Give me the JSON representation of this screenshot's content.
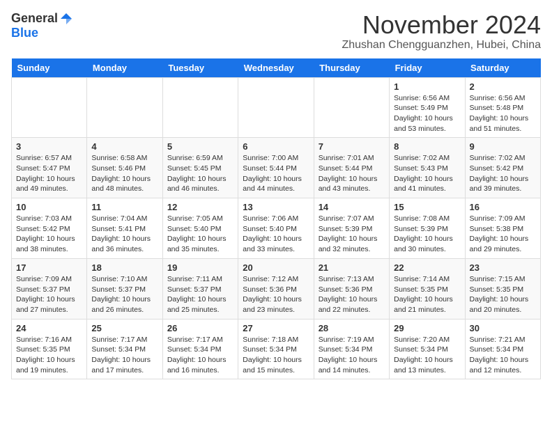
{
  "header": {
    "logo_general": "General",
    "logo_blue": "Blue",
    "month": "November 2024",
    "location": "Zhushan Chengguanzhen, Hubei, China"
  },
  "weekdays": [
    "Sunday",
    "Monday",
    "Tuesday",
    "Wednesday",
    "Thursday",
    "Friday",
    "Saturday"
  ],
  "weeks": [
    [
      {
        "day": "",
        "info": ""
      },
      {
        "day": "",
        "info": ""
      },
      {
        "day": "",
        "info": ""
      },
      {
        "day": "",
        "info": ""
      },
      {
        "day": "",
        "info": ""
      },
      {
        "day": "1",
        "info": "Sunrise: 6:56 AM\nSunset: 5:49 PM\nDaylight: 10 hours and 53 minutes."
      },
      {
        "day": "2",
        "info": "Sunrise: 6:56 AM\nSunset: 5:48 PM\nDaylight: 10 hours and 51 minutes."
      }
    ],
    [
      {
        "day": "3",
        "info": "Sunrise: 6:57 AM\nSunset: 5:47 PM\nDaylight: 10 hours and 49 minutes."
      },
      {
        "day": "4",
        "info": "Sunrise: 6:58 AM\nSunset: 5:46 PM\nDaylight: 10 hours and 48 minutes."
      },
      {
        "day": "5",
        "info": "Sunrise: 6:59 AM\nSunset: 5:45 PM\nDaylight: 10 hours and 46 minutes."
      },
      {
        "day": "6",
        "info": "Sunrise: 7:00 AM\nSunset: 5:44 PM\nDaylight: 10 hours and 44 minutes."
      },
      {
        "day": "7",
        "info": "Sunrise: 7:01 AM\nSunset: 5:44 PM\nDaylight: 10 hours and 43 minutes."
      },
      {
        "day": "8",
        "info": "Sunrise: 7:02 AM\nSunset: 5:43 PM\nDaylight: 10 hours and 41 minutes."
      },
      {
        "day": "9",
        "info": "Sunrise: 7:02 AM\nSunset: 5:42 PM\nDaylight: 10 hours and 39 minutes."
      }
    ],
    [
      {
        "day": "10",
        "info": "Sunrise: 7:03 AM\nSunset: 5:42 PM\nDaylight: 10 hours and 38 minutes."
      },
      {
        "day": "11",
        "info": "Sunrise: 7:04 AM\nSunset: 5:41 PM\nDaylight: 10 hours and 36 minutes."
      },
      {
        "day": "12",
        "info": "Sunrise: 7:05 AM\nSunset: 5:40 PM\nDaylight: 10 hours and 35 minutes."
      },
      {
        "day": "13",
        "info": "Sunrise: 7:06 AM\nSunset: 5:40 PM\nDaylight: 10 hours and 33 minutes."
      },
      {
        "day": "14",
        "info": "Sunrise: 7:07 AM\nSunset: 5:39 PM\nDaylight: 10 hours and 32 minutes."
      },
      {
        "day": "15",
        "info": "Sunrise: 7:08 AM\nSunset: 5:39 PM\nDaylight: 10 hours and 30 minutes."
      },
      {
        "day": "16",
        "info": "Sunrise: 7:09 AM\nSunset: 5:38 PM\nDaylight: 10 hours and 29 minutes."
      }
    ],
    [
      {
        "day": "17",
        "info": "Sunrise: 7:09 AM\nSunset: 5:37 PM\nDaylight: 10 hours and 27 minutes."
      },
      {
        "day": "18",
        "info": "Sunrise: 7:10 AM\nSunset: 5:37 PM\nDaylight: 10 hours and 26 minutes."
      },
      {
        "day": "19",
        "info": "Sunrise: 7:11 AM\nSunset: 5:37 PM\nDaylight: 10 hours and 25 minutes."
      },
      {
        "day": "20",
        "info": "Sunrise: 7:12 AM\nSunset: 5:36 PM\nDaylight: 10 hours and 23 minutes."
      },
      {
        "day": "21",
        "info": "Sunrise: 7:13 AM\nSunset: 5:36 PM\nDaylight: 10 hours and 22 minutes."
      },
      {
        "day": "22",
        "info": "Sunrise: 7:14 AM\nSunset: 5:35 PM\nDaylight: 10 hours and 21 minutes."
      },
      {
        "day": "23",
        "info": "Sunrise: 7:15 AM\nSunset: 5:35 PM\nDaylight: 10 hours and 20 minutes."
      }
    ],
    [
      {
        "day": "24",
        "info": "Sunrise: 7:16 AM\nSunset: 5:35 PM\nDaylight: 10 hours and 19 minutes."
      },
      {
        "day": "25",
        "info": "Sunrise: 7:17 AM\nSunset: 5:34 PM\nDaylight: 10 hours and 17 minutes."
      },
      {
        "day": "26",
        "info": "Sunrise: 7:17 AM\nSunset: 5:34 PM\nDaylight: 10 hours and 16 minutes."
      },
      {
        "day": "27",
        "info": "Sunrise: 7:18 AM\nSunset: 5:34 PM\nDaylight: 10 hours and 15 minutes."
      },
      {
        "day": "28",
        "info": "Sunrise: 7:19 AM\nSunset: 5:34 PM\nDaylight: 10 hours and 14 minutes."
      },
      {
        "day": "29",
        "info": "Sunrise: 7:20 AM\nSunset: 5:34 PM\nDaylight: 10 hours and 13 minutes."
      },
      {
        "day": "30",
        "info": "Sunrise: 7:21 AM\nSunset: 5:34 PM\nDaylight: 10 hours and 12 minutes."
      }
    ]
  ]
}
